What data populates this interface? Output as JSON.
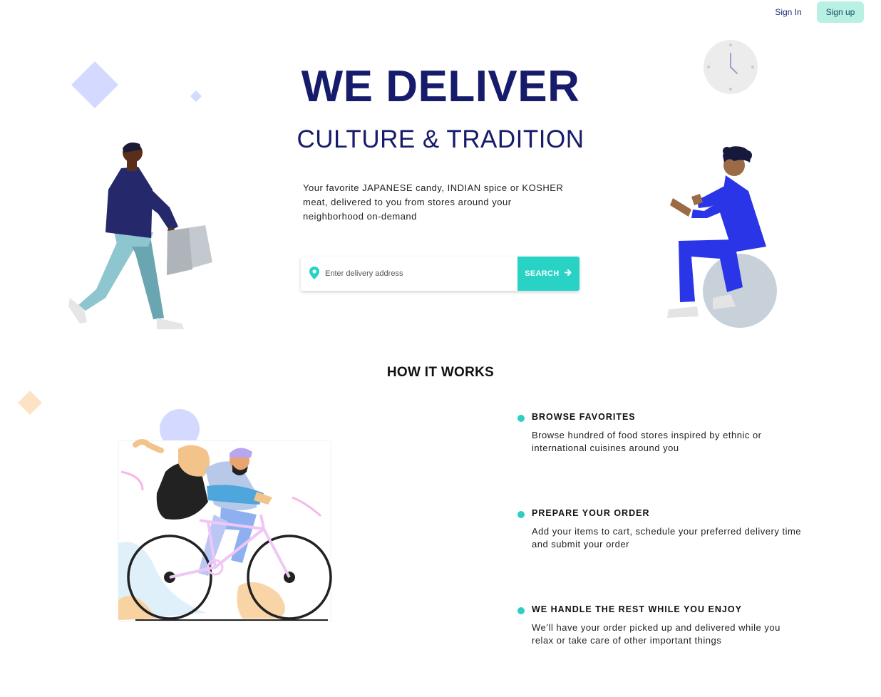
{
  "header": {
    "signin_label": "Sign In",
    "signup_label": "Sign up"
  },
  "hero": {
    "title": "WE DELIVER",
    "subtitle": "CULTURE & TRADITION",
    "description": "Your favorite JAPANESE candy, INDIAN spice or KOSHER meat, delivered to you from stores around your neighborhood on-demand"
  },
  "search": {
    "placeholder": "Enter delivery address",
    "button_label": "SEARCH"
  },
  "how_it_works": {
    "title": "HOW IT WORKS",
    "steps": [
      {
        "title": "BROWSE FAVORITES",
        "description": "Browse hundred of food stores inspired by ethnic or international cuisines around you"
      },
      {
        "title": "PREPARE YOUR ORDER",
        "description": "Add your items to cart, schedule your preferred delivery time and submit your order"
      },
      {
        "title": "WE HANDLE THE REST WHILE YOU ENJOY",
        "description": "We’ll have your order picked up and delivered while you relax or take care of other important things"
      }
    ]
  },
  "colors": {
    "brand_navy": "#161b6b",
    "accent_teal": "#28d3c6",
    "signup_bg": "#b8f0e3"
  },
  "icons": [
    "location-pin-icon",
    "arrow-right-icon",
    "clock-icon"
  ]
}
